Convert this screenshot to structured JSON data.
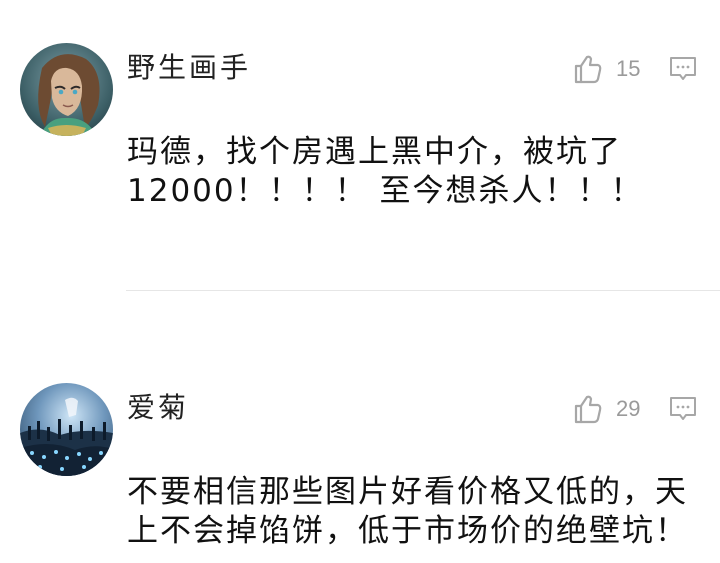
{
  "comments": [
    {
      "username": "野生画手",
      "likes": "15",
      "text": "玛德，找个房遇上黑中介，被坑了12000！！！！ 至今想杀人！！！",
      "avatar_icon": "avatar-anime-character",
      "like_icon": "thumbs-up-icon",
      "reply_icon": "comment-icon"
    },
    {
      "username": "爱菊",
      "likes": "29",
      "text": "不要相信那些图片好看价格又低的，天上不会掉馅饼，低于市场价的绝壁坑！",
      "avatar_icon": "avatar-army-scene",
      "like_icon": "thumbs-up-icon",
      "reply_icon": "comment-icon"
    }
  ],
  "colors": {
    "background": "#ffffff",
    "text": "#111111",
    "meta": "#9a9a9a",
    "divider": "#e6e6e6"
  }
}
